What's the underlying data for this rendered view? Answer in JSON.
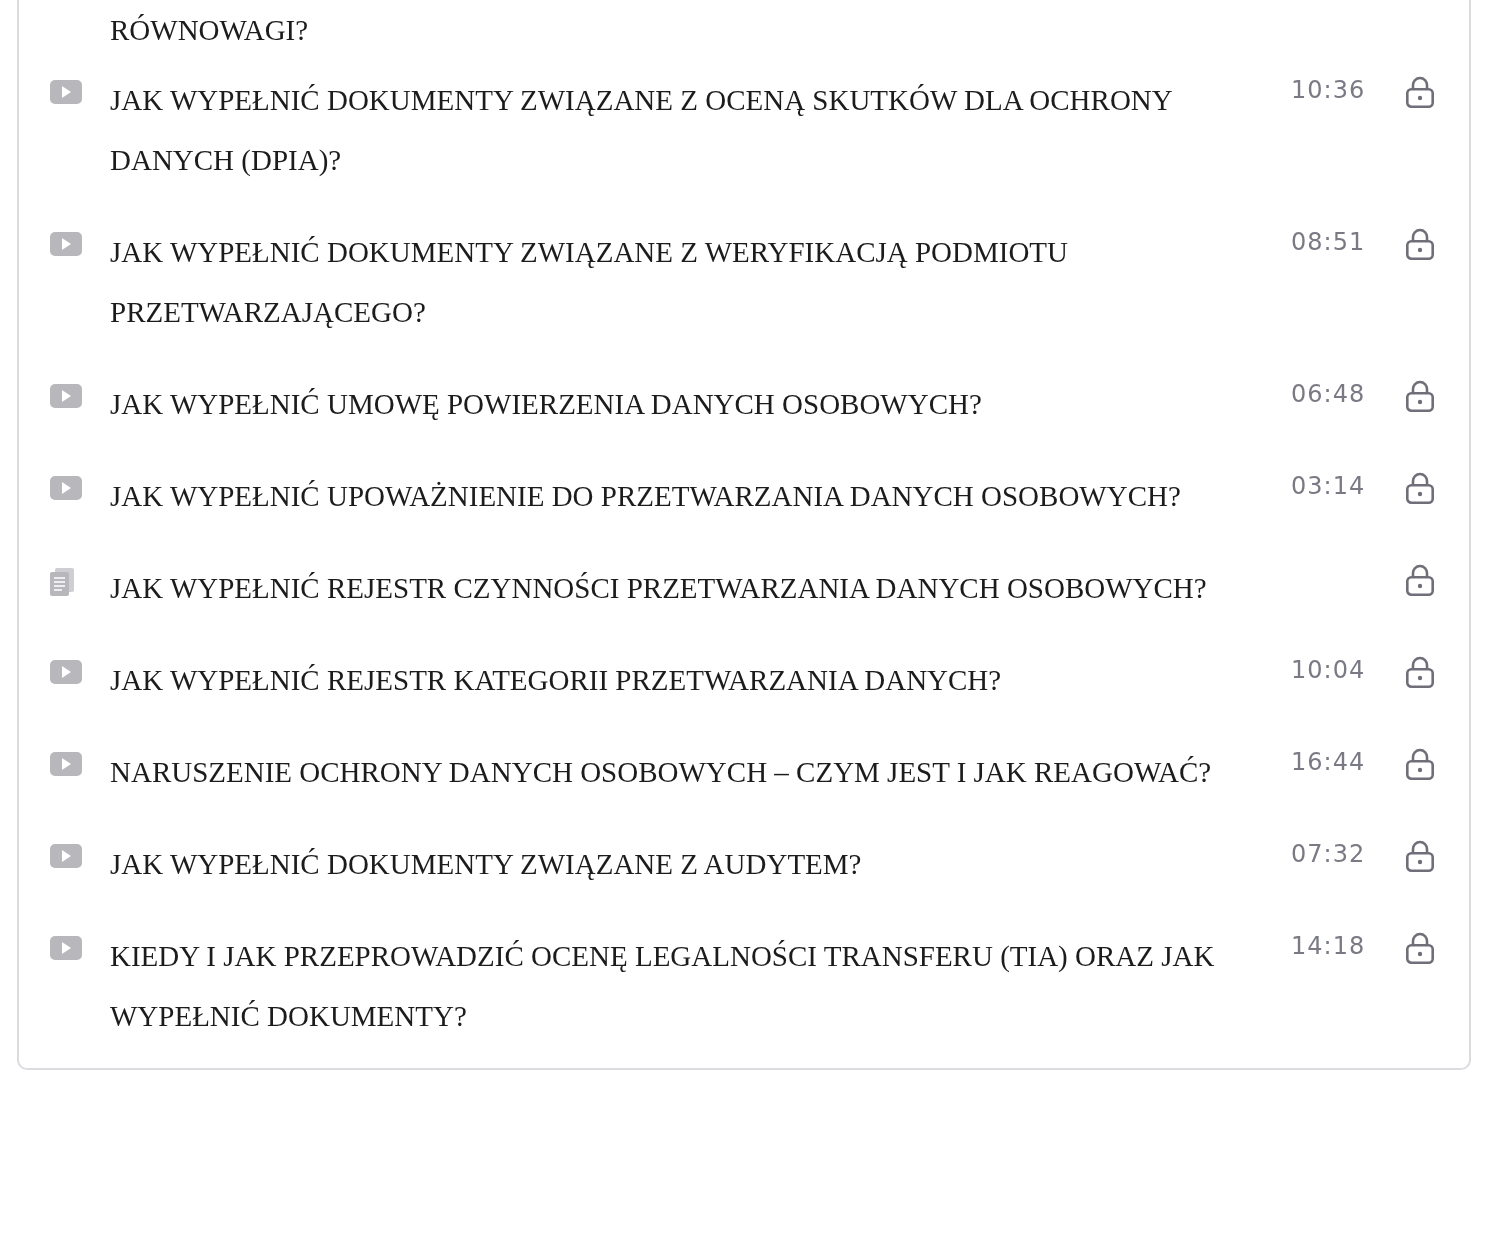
{
  "previous_item_tail": "RÓWNOWAGI?",
  "lessons": [
    {
      "kind": "video",
      "title": "JAK WYPEŁNIĆ DOKUMENTY ZWIĄZANE Z OCENĄ SKUTKÓW DLA OCHRONY DANYCH (DPIA)?",
      "duration": "10:36",
      "locked": true
    },
    {
      "kind": "video",
      "title": "JAK WYPEŁNIĆ DOKUMENTY ZWIĄZANE Z WERYFIKACJĄ PODMIOTU PRZETWARZAJĄCEGO?",
      "duration": "08:51",
      "locked": true
    },
    {
      "kind": "video",
      "title": "JAK WYPEŁNIĆ UMOWĘ POWIERZENIA DANYCH OSOBOWYCH?",
      "duration": "06:48",
      "locked": true
    },
    {
      "kind": "video",
      "title": "JAK WYPEŁNIĆ UPOWAŻNIENIE DO PRZETWARZANIA DANYCH OSOBOWYCH?",
      "duration": "03:14",
      "locked": true
    },
    {
      "kind": "document",
      "title": "JAK WYPEŁNIĆ REJESTR CZYNNOŚCI PRZETWARZANIA DANYCH OSOBOWYCH?",
      "locked": true
    },
    {
      "kind": "video",
      "title": "JAK WYPEŁNIĆ REJESTR KATEGORII PRZETWARZANIA DANYCH?",
      "duration": "10:04",
      "locked": true
    },
    {
      "kind": "video",
      "title": "NARUSZENIE OCHRONY DANYCH OSOBOWYCH – CZYM JEST I JAK REAGOWAĆ?",
      "duration": "16:44",
      "locked": true
    },
    {
      "kind": "video",
      "title": "JAK WYPEŁNIĆ DOKUMENTY ZWIĄZANE Z AUDYTEM?",
      "duration": "07:32",
      "locked": true
    },
    {
      "kind": "video",
      "title": "KIEDY I JAK PRZEPROWADZIĆ OCENĘ LEGALNOŚCI TRANSFERU (TIA) ORAZ JAK WYPEŁNIĆ DOKUMENTY?",
      "duration": "14:18",
      "locked": true
    }
  ]
}
